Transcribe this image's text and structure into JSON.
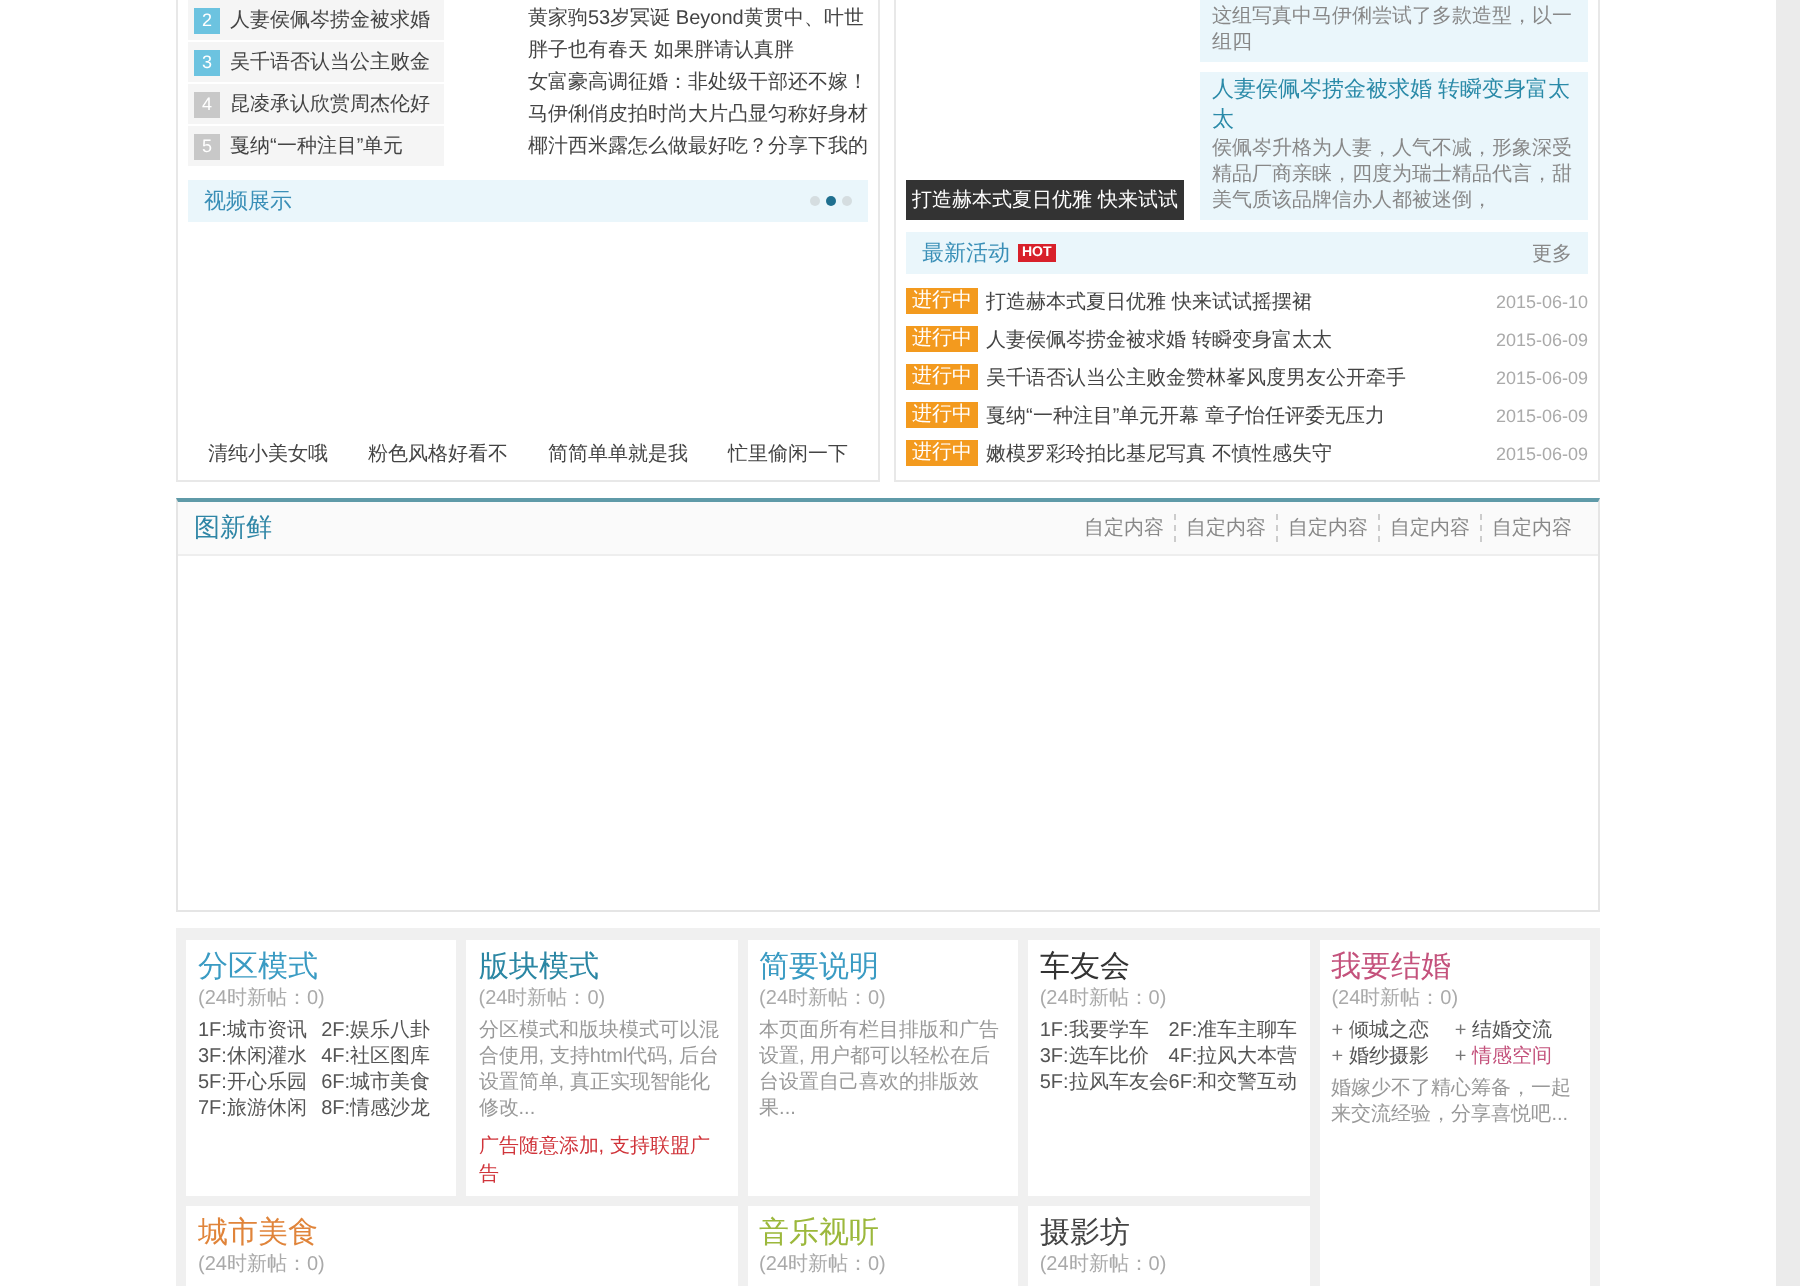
{
  "hot_list": [
    {
      "rank": "2",
      "title": "人妻侯佩岑捞金被求婚",
      "highlighted": true
    },
    {
      "rank": "3",
      "title": "吴千语否认当公主败金",
      "highlighted": true
    },
    {
      "rank": "4",
      "title": "昆凌承认欣赏周杰伦好",
      "highlighted": false
    },
    {
      "rank": "5",
      "title": "戛纳“一种注目”单元",
      "highlighted": false
    }
  ],
  "news_lines": [
    "黄家驹53岁冥诞 Beyond黄贯中、叶世",
    "胖子也有春天 如果胖请认真胖",
    "女富豪高调征婚：非处级干部还不嫁！",
    "马伊俐俏皮拍时尚大片凸显匀称好身材",
    "椰汁西米露怎么做最好吃？分享下我的"
  ],
  "video_section": {
    "title": "视频展示",
    "dots": [
      {
        "selected": false
      },
      {
        "selected": true
      },
      {
        "selected": false
      }
    ],
    "videos": [
      "清纯小美女哦",
      "粉色风格好看不",
      "简简单单就是我",
      "忙里偷闲一下"
    ]
  },
  "feature": {
    "caption": "打造赫本式夏日优雅 快来试试",
    "boxes": [
      {
        "description": "这组写真中马伊俐尝试了多款造型，以一组四"
      },
      {
        "title": "人妻侯佩岑捞金被求婚 转瞬变身富太太",
        "description": "侯佩岑升格为人妻，人气不减，形象深受精品厂商亲睐，四度为瑞士精品代言，甜美气质该品牌信办人都被迷倒，"
      }
    ]
  },
  "activities": {
    "title": "最新活动",
    "badge": "HOT",
    "more": "更多",
    "items": [
      {
        "status": "进行中",
        "title": "打造赫本式夏日优雅 快来试试摇摆裙",
        "date": "2015-06-10"
      },
      {
        "status": "进行中",
        "title": "人妻侯佩岑捞金被求婚 转瞬变身富太太",
        "date": "2015-06-09"
      },
      {
        "status": "进行中",
        "title": "吴千语否认当公主败金赞林峯风度男友公开牵手",
        "date": "2015-06-09"
      },
      {
        "status": "进行中",
        "title": "戛纳“一种注目”单元开幕 章子怡任评委无压力",
        "date": "2015-06-09"
      },
      {
        "status": "进行中",
        "title": "嫩模罗彩玲拍比基尼写真 不慎性感失守",
        "date": "2015-06-09"
      }
    ]
  },
  "gallery": {
    "title": "图新鲜",
    "links": [
      "自定内容",
      "自定内容",
      "自定内容",
      "自定内容",
      "自定内容"
    ]
  },
  "forums": [
    {
      "kind": "boards",
      "title": "分区模式",
      "color": "#3a9bc3",
      "subtitle": "(24时新帖：0)",
      "boards": [
        "1F:城市资讯",
        "2F:娱乐八卦",
        "3F:休闲灌水",
        "4F:社区图库",
        "5F:开心乐园",
        "6F:城市美食",
        "7F:旅游休闲",
        "8F:情感沙龙"
      ]
    },
    {
      "kind": "text",
      "title": "版块模式",
      "color": "#2a86a3",
      "subtitle": "(24时新帖：0)",
      "description": "分区模式和版块模式可以混合使用, 支持html代码, 后台设置简单, 真正实现智能化修改...",
      "ad": "广告随意添加, 支持联盟广告"
    },
    {
      "kind": "text",
      "title": "简要说明",
      "color": "#3a9bc3",
      "subtitle": "(24时新帖：0)",
      "description": "本页面所有栏目排版和广告设置, 用户都可以轻松在后台设置自己喜欢的排版效果..."
    },
    {
      "kind": "boards",
      "title": "车友会",
      "color": "#333333",
      "subtitle": "(24时新帖：0)",
      "boards": [
        "1F:我要学车",
        "2F:准车主聊车",
        "3F:选车比价",
        "4F:拉风大本营",
        "5F:拉风车友会",
        "6F:和交警互动"
      ]
    },
    {
      "kind": "tags",
      "title": "我要结婚",
      "color": "#c4527c",
      "subtitle": "(24时新帖：0)",
      "tags": [
        {
          "bullet": "+",
          "label": "倾城之恋",
          "highlighted": false
        },
        {
          "bullet": "+",
          "label": "结婚交流",
          "highlighted": false
        },
        {
          "bullet": "+",
          "label": "婚纱摄影",
          "highlighted": false
        },
        {
          "bullet": "+",
          "label": "情感空间",
          "highlighted": true
        }
      ],
      "description": "婚嫁少不了精心筹备，一起来交流经验，分享喜悦吧..."
    },
    {
      "kind": "brief",
      "title": "城市美食",
      "color": "#e0843a",
      "subtitle": "(24时新帖：0)"
    },
    {
      "kind": "brief",
      "title": "音乐视听",
      "color": "#9cb83c",
      "subtitle": "(24时新帖：0)"
    },
    {
      "kind": "brief",
      "title": "摄影坊",
      "color": "#444444",
      "subtitle": "(24时新帖：0)"
    }
  ]
}
